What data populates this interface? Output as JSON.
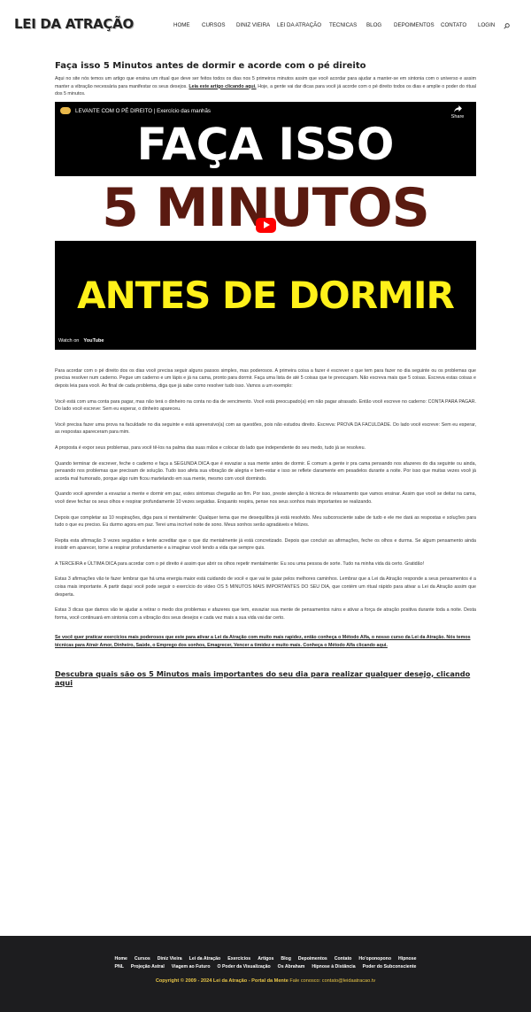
{
  "site": {
    "logo": "LEI DA ATRAÇÃO"
  },
  "nav": {
    "items": [
      "HOME",
      "CURSOS",
      "DINIZ VIEIRA",
      "LEI DA ATRAÇÃO",
      "TECNICAS",
      "BLOG",
      "DEPOIMENTOS",
      "CONTATO",
      "LOGIN"
    ],
    "search_icon": "search-icon"
  },
  "article": {
    "title": "Faça isso 5 Minutos antes de dormir e acorde com o pé direito",
    "intro_text": "Aqui no site nós temos um artigo que ensina um ritual que deve ser feitos todos os dias nos 5 primeiros minutos assim que você acordar para ajudar a manter-se em sintonia com o universo e assim manter a vibração necessária para manifestar os seus desejos.",
    "intro_link": "Leia este artigo clicando aqui.",
    "intro_tail": "Hoje, a gente vai dar dicas para você já acorde com o pé direito todos os dias e amplie o poder do ritual dos 5 minutos.",
    "paragraphs": [
      "Para acordar com o pé direito dos os dias você precisa seguir alguns passos simples, mas poderosos. A primeira coisa a fazer é escrever o que tem para fazer no dia seguinte ou os problemas que precisa resolver num caderno. Pegue um caderno e um lápis e já na cama, pronto para dormir. Faça uma lista de até 5 coisas que te preocupam. Não escreva mais que 5 coisas. Escreva estas coisas e depois leia para você. Ao final de cada problema, diga que já sabe como resolver tudo isso. Vamos a um exemplo:",
      "Você está com uma conta para pagar, mas não terá o dinheiro na conta no dia de vencimento. Você está preocupado(a) em não pagar atrasado. Então você escreve no caderno: CONTA PARA PAGAR. Do lado você escreve: Sem eu esperar, o dinheiro apareceu.",
      "Você precisa fazer uma prova na faculdade no dia seguinte e está apreensivo(a) com as questões, pois não estudou direito. Escreva: PROVA DA FACULDADE. Do lado você escreve: Sem eu esperar, as respostas apareceram para mim.",
      "A proposta é expor seus problemas, para você tê-los na palma das suas mãos e colocar do lado que independente do seu medo, tudo já se resolveu.",
      "Quando terminar de escrever, feche o caderno e faça a SEGUNDA DICA que é esvaziar a sua mente antes de dormir. É comum a gente ir pra cama pensando nos afazeres do dia seguinte ou ainda, pensando nos problemas que precisam de solução. Tudo isso afeta sua vibração de alegria e bem-estar e isso se reflete claramente em pesadelos durante a noite. Por isso que muitas vezes você já acorda mal humorado, porque algo ruim ficou martelando em sua mente, mesmo com você dormindo.",
      "Quando você aprender a esvaziar a mente e dormir em paz, estes sintomas chegarão ao fim. Por isso, preste atenção à técnica de relaxamento que vamos ensinar. Assim que você se deitar na cama, você deve fechar os seus olhos e respirar profundamente 10 vezes seguidas. Enquanto respira, pense nos seus sonhos mais importantes se realizando.",
      "Depois que completar as 10 respirações, diga para si mentalmente: Qualquer tema que me desequilibra já está resolvido. Meu subconsciente sabe de tudo e ele me dará as respostas e soluções para tudo o que eu preciso. Eu durmo agora em paz. Terei uma incrível noite de sono. Meus sonhos serão agradáveis e felizes.",
      "Repita esta afirmação 3 vezes seguidas e tente acreditar que o que diz mentalmente já está concretizado. Depois que concluir as afirmações, feche os olhos e durma. Se algum pensamento ainda insistir em aparecer, torne a respirar profundamente e a imaginar você tendo a vida que sempre quis.",
      "A TERCEIRA e ÚLTIMA DICA para acordar com o pé direito é assim que abrir os olhos repetir mentalmente: Eu sou uma pessoa de sorte. Tudo na minha vida dá certo. Gratidão!",
      "Estas 3 afirmações vão te fazer lembrar que há uma energia maior está cuidando de você e que vai te guiar pelos melhores caminhos. Lembrar que a Lei da Atração responde a seus pensamentos é a coisa mais importante. A partir daqui você pode seguir o exercício do vídeo OS 5 MINUTOS MAIS IMPORTANTES DO SEU DIA, que contém um ritual rápido para ativar a Lei da Atração assim que desperta.",
      "Estas 3 dicas que damos vão te ajudar a retirar o medo dos problemas e afazeres que tem, esvaziar sua mente de pensamentos ruins e ativar a força de atração positiva durante toda a noite. Desta forma, você continuará em sintonia com a vibração dos seus desejos e cada vez mais a sua vida vai dar certo."
    ],
    "cta_text": "Se você quer praticar exercícios mais poderosos que este para ativar a Lei da Atração com muito mais rapidez, então conheça o Método Alfa, o nosso curso da Lei da Atração. Nós temos técnicas para Atrair Amor, Dinheiro, Saúde, o Emprego dos sonhos, Emagrecer, Vencer a timidez e muito mais. Conheça o Método Alfa clicando aqui.",
    "bottom_link": "Descubra quais são os 5 Minutos mais importantes do seu dia para realizar qualquer desejo, clicando aqui"
  },
  "video": {
    "title": "LEVANTE COM O PÉ DIREITO | Exercício das manhãs",
    "share_label": "Share",
    "thumb_line1": "FAÇA ISSO",
    "thumb_line2": "5 MINUTOS",
    "thumb_line3": "ANTES DE DORMIR",
    "watch_on": "Watch on",
    "youtube_label": "YouTube",
    "colors": {
      "line2": "#5a1a10",
      "line3": "#fff11a",
      "play": "#ff0000"
    }
  },
  "footer": {
    "row1": [
      "Home",
      "Cursos",
      "Diniz Vieira",
      "Lei da Atração",
      "Exercícios",
      "Artigos",
      "Blog",
      "Depoimentos",
      "Contato",
      "Ho'oponopono",
      "Hipnose"
    ],
    "row2": [
      "PNL",
      "Projeção Astral",
      "Viagem ao Futuro",
      "O Poder da Visualização",
      "Os Abraham",
      "Hipnose à Distância",
      "Poder do Subconsciente"
    ],
    "copyright": "Copyright © 2009 - 2024 Lei da Atração - Portal da Mente",
    "contact": "Fale conosco: contato@leidaatracao.tv",
    "colors": {
      "background": "#1d1d1f",
      "copyright": "#e8c547"
    }
  }
}
